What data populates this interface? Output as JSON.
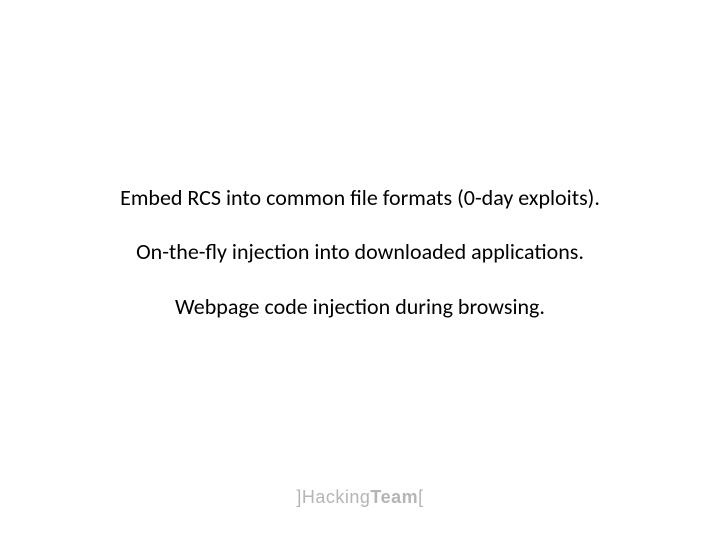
{
  "slide": {
    "lines": [
      "Embed RCS into common file formats (0-day exploits).",
      "On-the-fly injection into downloaded applications.",
      "Webpage code injection during browsing."
    ],
    "logo": {
      "open_bracket": "]",
      "part1": "Hacking",
      "part2": "Team",
      "close_bracket": "["
    }
  }
}
